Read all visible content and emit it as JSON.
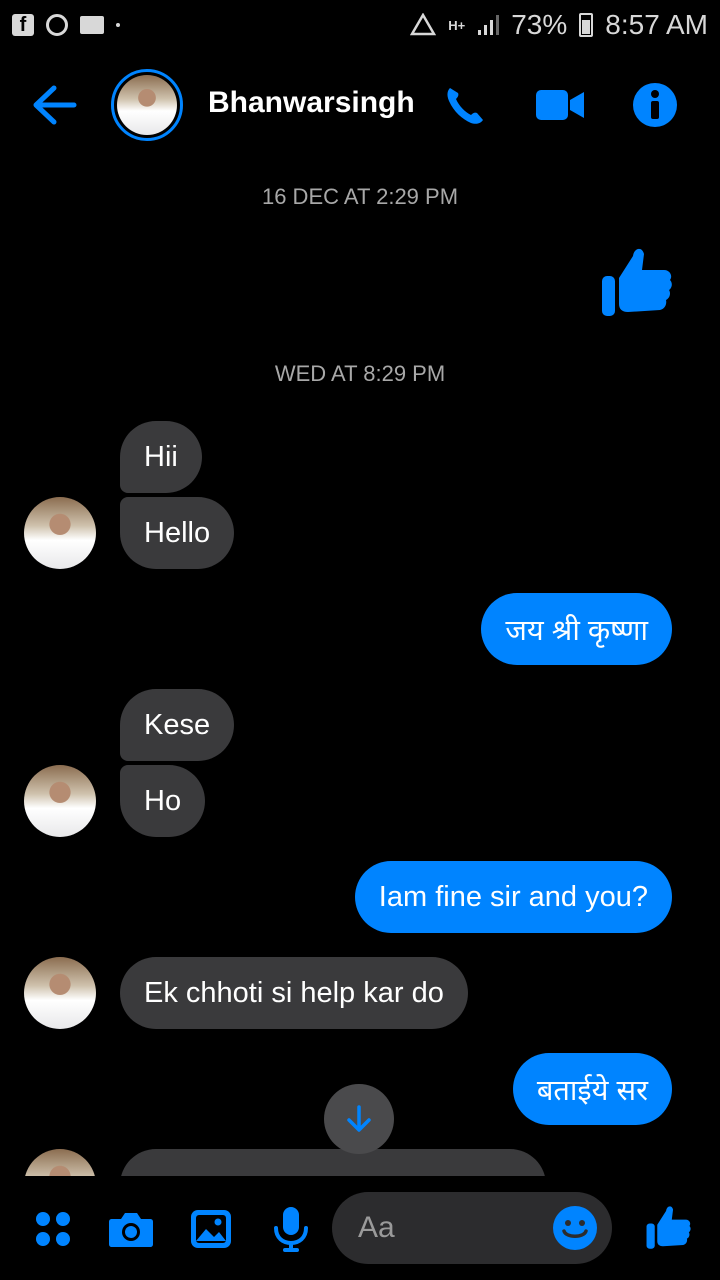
{
  "status_bar": {
    "battery": "73%",
    "time": "8:57 AM",
    "network": "H+",
    "icons": [
      "facebook-icon",
      "chrome-icon",
      "folder-icon",
      "dot-icon",
      "data-saver-icon",
      "signal-icon",
      "battery-icon"
    ]
  },
  "header": {
    "contact_name": "Bhanwarsingh",
    "back_icon": "arrow-left-icon",
    "call_icon": "phone-icon",
    "video_icon": "video-camera-icon",
    "info_icon": "info-icon"
  },
  "colors": {
    "accent": "#0084ff",
    "incoming_bubble": "#3a3a3c",
    "background": "#000000"
  },
  "messages": {
    "ts1": "16 DEC AT 2:29 PM",
    "like_icon": "thumbs-up-icon",
    "ts2": "WED AT 8:29 PM",
    "m1": "Hii",
    "m2": "Hello",
    "m3": "जय श्री कृष्णा",
    "m4": "Kese",
    "m5": "Ho",
    "m6": "Iam fine sir and you?",
    "m7": "Ek chhoti si help kar do",
    "m8": "बताईये सर"
  },
  "composer": {
    "placeholder": "Aa",
    "icons": [
      "apps-icon",
      "camera-icon",
      "gallery-icon",
      "microphone-icon",
      "emoji-icon",
      "thumbs-up-icon"
    ]
  }
}
